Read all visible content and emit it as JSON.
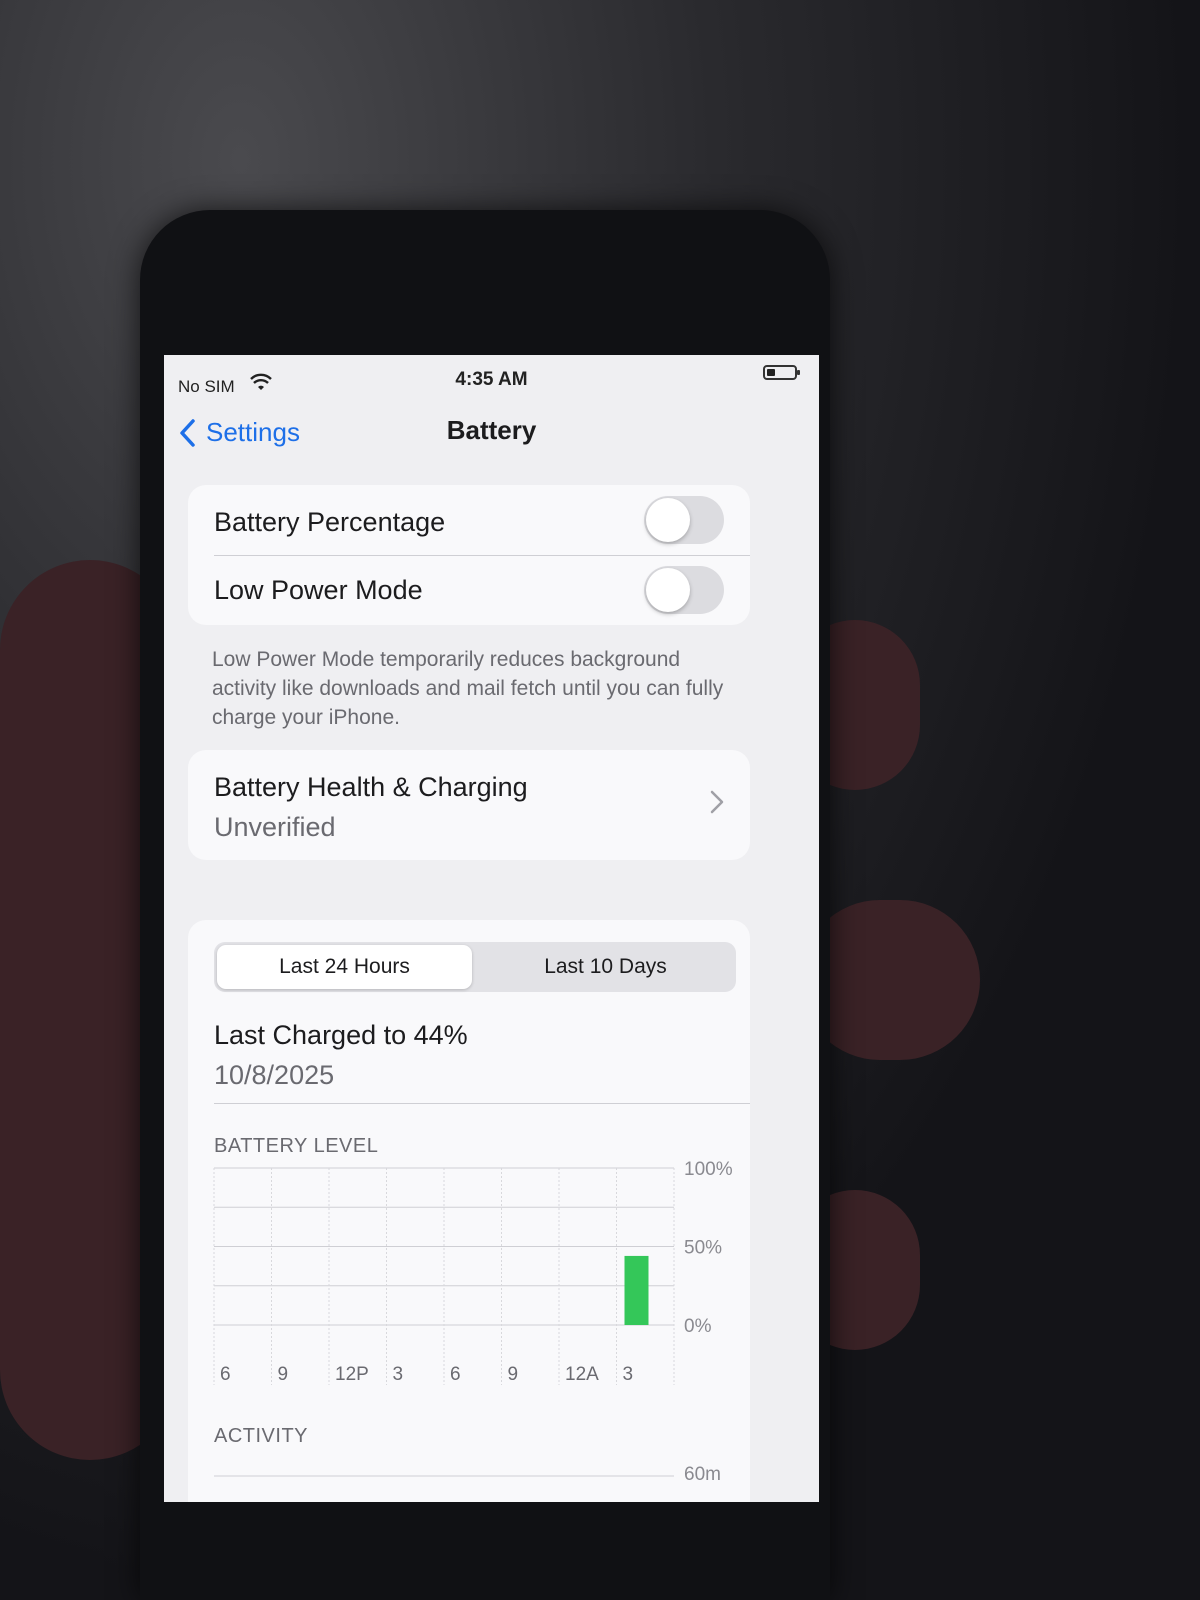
{
  "status_bar": {
    "carrier": "No SIM",
    "time": "4:35 AM",
    "battery_level_fraction": 0.3
  },
  "nav": {
    "back_label": "Settings",
    "title": "Battery"
  },
  "toggles": [
    {
      "label": "Battery Percentage",
      "on": false
    },
    {
      "label": "Low Power Mode",
      "on": false
    }
  ],
  "low_power_footnote": "Low Power Mode temporarily reduces background activity like downloads and mail fetch until you can fully charge your iPhone.",
  "health": {
    "title": "Battery Health & Charging",
    "status": "Unverified"
  },
  "usage": {
    "tabs": [
      "Last 24 Hours",
      "Last 10 Days"
    ],
    "selected_tab": "Last 24 Hours",
    "last_charged": "Last Charged to 44%",
    "last_charged_date": "10/8/2025"
  },
  "chart_data": [
    {
      "type": "bar",
      "title": "BATTERY LEVEL",
      "categories": [
        "6",
        "9",
        "12P",
        "3",
        "6",
        "9",
        "12A",
        "3"
      ],
      "y_tick_labels": [
        "100%",
        "50%",
        "0%"
      ],
      "ylim": [
        0,
        100
      ],
      "series": [
        {
          "values": [
            0,
            0,
            0,
            0,
            0,
            0,
            0,
            44
          ]
        }
      ],
      "bar_color": "#34c759"
    },
    {
      "type": "bar",
      "title": "ACTIVITY",
      "y_tick_labels": [
        "60m"
      ],
      "ylim": [
        0,
        60
      ],
      "series": []
    }
  ]
}
